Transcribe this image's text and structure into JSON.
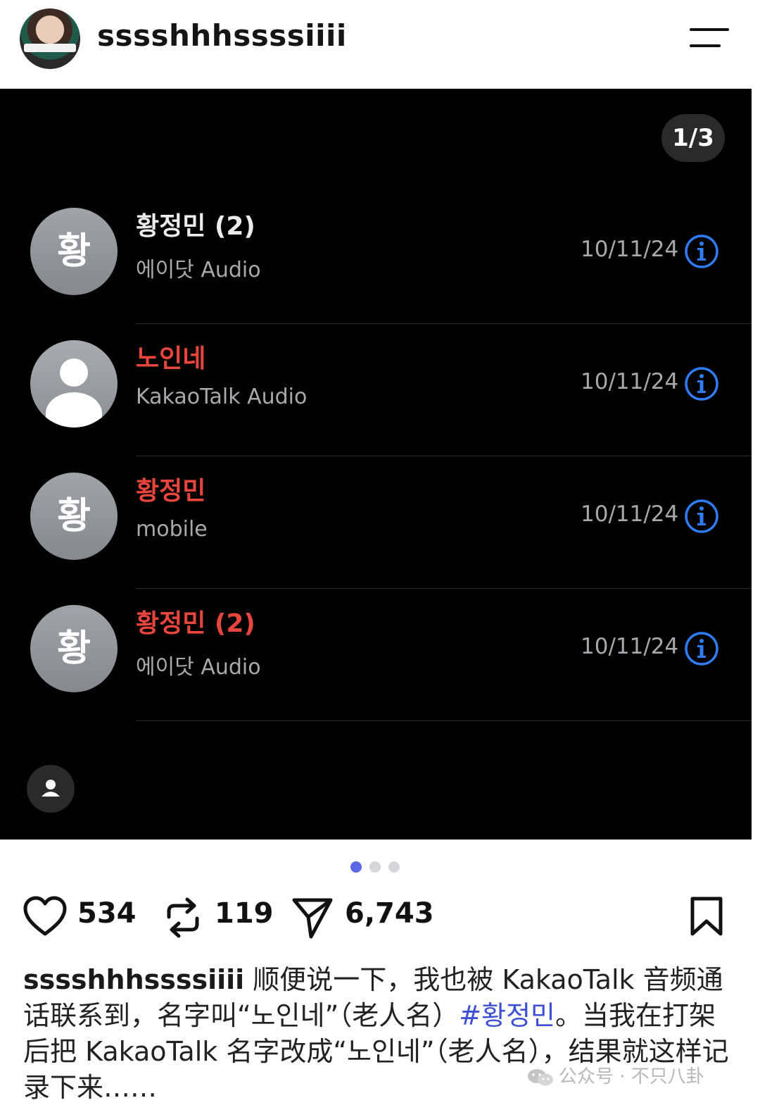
{
  "header": {
    "username": "sssshhhssssiiii"
  },
  "carousel": {
    "counter": "1/3",
    "pages": 3,
    "active_page": 1
  },
  "calls": [
    {
      "avatar_char": "황",
      "name": "황정민 (2)",
      "missed": false,
      "type": "에이닷 Audio",
      "date": "10/11/24"
    },
    {
      "avatar_char": "",
      "name": "노인네",
      "missed": true,
      "type": "KakaoTalk Audio",
      "date": "10/11/24"
    },
    {
      "avatar_char": "황",
      "name": "황정민",
      "missed": true,
      "type": "mobile",
      "date": "10/11/24"
    },
    {
      "avatar_char": "황",
      "name": "황정민 (2)",
      "missed": true,
      "type": "에이닷 Audio",
      "date": "10/11/24"
    }
  ],
  "actions": {
    "likes": "534",
    "reposts": "119",
    "shares": "6,743"
  },
  "caption": {
    "username": "sssshhhssssiiii",
    "text_before": " 顺便说一下，我也被 KakaoTalk 音频通话联系到，名字叫“노인네”（老人名）",
    "hashtag": "#황정민",
    "text_after": "。当我在打架后把 KakaoTalk 名字改成“노인네”（老人名），结果就这样记录下来……"
  },
  "watermark": {
    "text": "公众号 · 不只八卦"
  },
  "colors": {
    "missed_call": "#e8453d",
    "info_blue": "#2f7cf6",
    "hashtag": "#3d4fd6",
    "dot_active": "#5b67e6"
  }
}
